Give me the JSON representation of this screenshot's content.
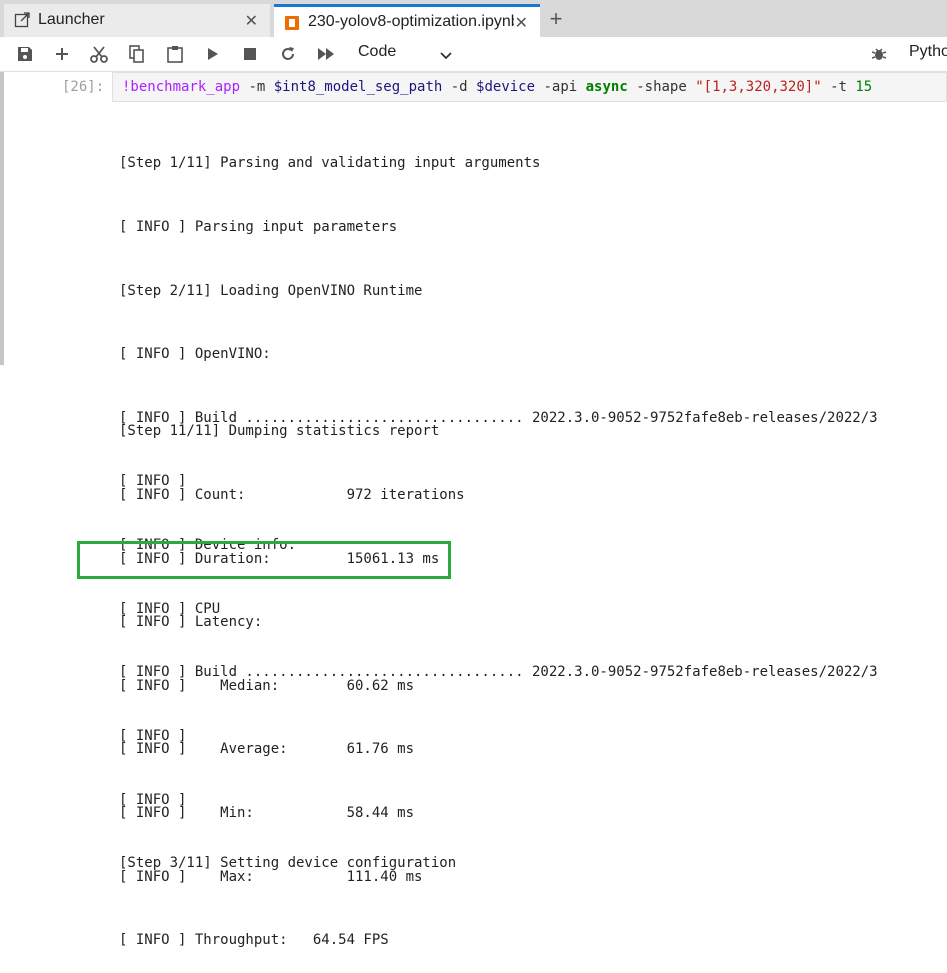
{
  "tabs": [
    {
      "label": "Launcher",
      "icon": "launcher-icon"
    },
    {
      "label": "230-yolov8-optimization.ipynb",
      "icon": "notebook-icon"
    }
  ],
  "new_tab": "+",
  "toolbar": {
    "cell_type": "Code",
    "kernel": "Python"
  },
  "cell": {
    "prompt": "[26]:",
    "code": {
      "magic": "!benchmark_app",
      "p1": " -m ",
      "var1": "$int8_model_seg_path",
      "p2": " -d ",
      "var2": "$device",
      "p3": " -api ",
      "kw": "async",
      "p4": " -shape ",
      "str": "\"[1,3,320,320]\"",
      "p5": " -t ",
      "num": "15"
    }
  },
  "output_top": [
    "[Step 1/11] Parsing and validating input arguments",
    "[ INFO ] Parsing input parameters",
    "[Step 2/11] Loading OpenVINO Runtime",
    "[ INFO ] OpenVINO:",
    "[ INFO ] Build ................................. 2022.3.0-9052-9752fafe8eb-releases/2022/3",
    "[ INFO ]",
    "[ INFO ] Device info:",
    "[ INFO ] CPU",
    "[ INFO ] Build ................................. 2022.3.0-9052-9752fafe8eb-releases/2022/3",
    "[ INFO ]",
    "[ INFO ]",
    "[Step 3/11] Setting device configuration"
  ],
  "output_bottom": [
    "[Step 11/11] Dumping statistics report",
    "[ INFO ] Count:            972 iterations",
    "[ INFO ] Duration:         15061.13 ms",
    "[ INFO ] Latency:",
    "[ INFO ]    Median:        60.62 ms",
    "[ INFO ]    Average:       61.76 ms",
    "[ INFO ]    Min:           58.44 ms",
    "[ INFO ]    Max:           111.40 ms",
    "[ INFO ] Throughput:   64.54 FPS"
  ],
  "colors": {
    "accent": "#1976d2",
    "highlight_border": "#2ea843"
  }
}
